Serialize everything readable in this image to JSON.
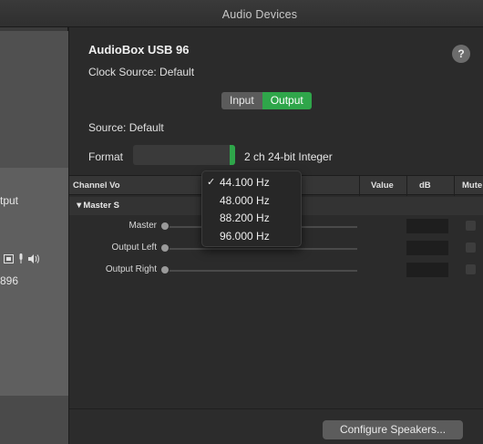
{
  "window": {
    "title": "Audio Devices"
  },
  "sidebar": {
    "partial_label_1": "tput",
    "partial_label_2": "896",
    "icons": [
      "screen-icon",
      "microphone-icon",
      "speaker-icon"
    ]
  },
  "device": {
    "name": "AudioBox USB 96",
    "clock_source": "Clock Source:  Default",
    "help_glyph": "?"
  },
  "segment": {
    "input_label": "Input",
    "output_label": "Output",
    "selected": "Output"
  },
  "source": {
    "label": "Source:  Default"
  },
  "format": {
    "label": "Format",
    "channels": "2 ch 24-bit Integer",
    "options": [
      "44.100 Hz",
      "48.000 Hz",
      "88.200 Hz",
      "96.000 Hz"
    ],
    "selected": "44.100 Hz",
    "check_glyph": "✓"
  },
  "table": {
    "headers": {
      "channel": "Channel Vo",
      "value": "Value",
      "db": "dB",
      "mute": "Mute"
    },
    "group": "▼Master S",
    "rows": [
      {
        "label": "Master"
      },
      {
        "label": "Output Left"
      },
      {
        "label": "Output Right"
      }
    ]
  },
  "footer": {
    "configure_button": "Configure Speakers..."
  },
  "colors": {
    "accent_green": "#2fa64a",
    "background": "#2b2b2b"
  }
}
